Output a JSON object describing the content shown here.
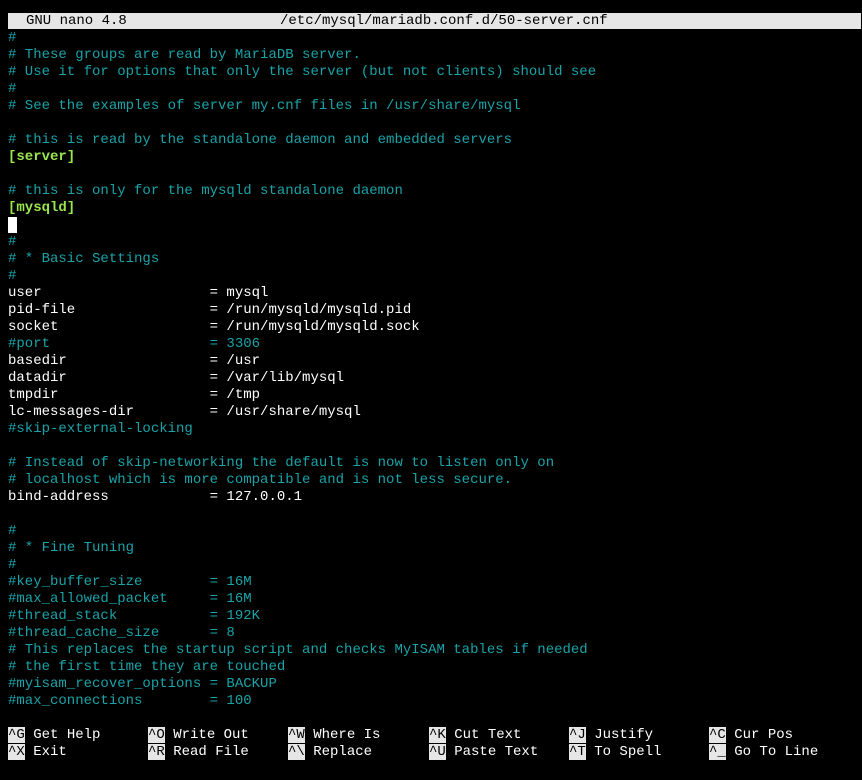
{
  "title_bar": {
    "app": "GNU nano 4.8",
    "file_path": "/etc/mysql/mariadb.conf.d/50-server.cnf"
  },
  "lines": [
    {
      "kind": "comment",
      "text": "#"
    },
    {
      "kind": "comment",
      "text": "# These groups are read by MariaDB server."
    },
    {
      "kind": "comment",
      "text": "# Use it for options that only the server (but not clients) should see"
    },
    {
      "kind": "comment",
      "text": "#"
    },
    {
      "kind": "comment",
      "text": "# See the examples of server my.cnf files in /usr/share/mysql"
    },
    {
      "kind": "blank",
      "text": ""
    },
    {
      "kind": "comment",
      "text": "# this is read by the standalone daemon and embedded servers"
    },
    {
      "kind": "section",
      "text": "[server]"
    },
    {
      "kind": "blank",
      "text": ""
    },
    {
      "kind": "comment",
      "text": "# this is only for the mysqld standalone daemon"
    },
    {
      "kind": "section",
      "text": "[mysqld]"
    },
    {
      "kind": "cursor",
      "text": ""
    },
    {
      "kind": "comment",
      "text": "#"
    },
    {
      "kind": "comment",
      "text": "# * Basic Settings"
    },
    {
      "kind": "comment",
      "text": "#"
    },
    {
      "kind": "setting",
      "text": "user                    = mysql"
    },
    {
      "kind": "setting",
      "text": "pid-file                = /run/mysqld/mysqld.pid"
    },
    {
      "kind": "setting",
      "text": "socket                  = /run/mysqld/mysqld.sock"
    },
    {
      "kind": "comment",
      "text": "#port                   = 3306"
    },
    {
      "kind": "setting",
      "text": "basedir                 = /usr"
    },
    {
      "kind": "setting",
      "text": "datadir                 = /var/lib/mysql"
    },
    {
      "kind": "setting",
      "text": "tmpdir                  = /tmp"
    },
    {
      "kind": "setting",
      "text": "lc-messages-dir         = /usr/share/mysql"
    },
    {
      "kind": "comment",
      "text": "#skip-external-locking"
    },
    {
      "kind": "blank",
      "text": ""
    },
    {
      "kind": "comment",
      "text": "# Instead of skip-networking the default is now to listen only on"
    },
    {
      "kind": "comment",
      "text": "# localhost which is more compatible and is not less secure."
    },
    {
      "kind": "setting",
      "text": "bind-address            = 127.0.0.1"
    },
    {
      "kind": "blank",
      "text": ""
    },
    {
      "kind": "comment",
      "text": "#"
    },
    {
      "kind": "comment",
      "text": "# * Fine Tuning"
    },
    {
      "kind": "comment",
      "text": "#"
    },
    {
      "kind": "comment",
      "text": "#key_buffer_size        = 16M"
    },
    {
      "kind": "comment",
      "text": "#max_allowed_packet     = 16M"
    },
    {
      "kind": "comment",
      "text": "#thread_stack           = 192K"
    },
    {
      "kind": "comment",
      "text": "#thread_cache_size      = 8"
    },
    {
      "kind": "comment",
      "text": "# This replaces the startup script and checks MyISAM tables if needed"
    },
    {
      "kind": "comment",
      "text": "# the first time they are touched"
    },
    {
      "kind": "comment",
      "text": "#myisam_recover_options = BACKUP"
    },
    {
      "kind": "comment",
      "text": "#max_connections        = 100"
    }
  ],
  "shortcuts": [
    {
      "key": "^G",
      "label": "Get Help"
    },
    {
      "key": "^O",
      "label": "Write Out"
    },
    {
      "key": "^W",
      "label": "Where Is"
    },
    {
      "key": "^K",
      "label": "Cut Text"
    },
    {
      "key": "^J",
      "label": "Justify"
    },
    {
      "key": "^C",
      "label": "Cur Pos"
    },
    {
      "key": "^X",
      "label": "Exit"
    },
    {
      "key": "^R",
      "label": "Read File"
    },
    {
      "key": "^\\",
      "label": "Replace"
    },
    {
      "key": "^U",
      "label": "Paste Text"
    },
    {
      "key": "^T",
      "label": "To Spell"
    },
    {
      "key": "^_",
      "label": "Go To Line"
    }
  ],
  "colors": {
    "background": "#000000",
    "comment": "#1aa3a8",
    "section": "#9ae64d",
    "text": "#ffffff",
    "title_bar": "#e6e6e6"
  }
}
